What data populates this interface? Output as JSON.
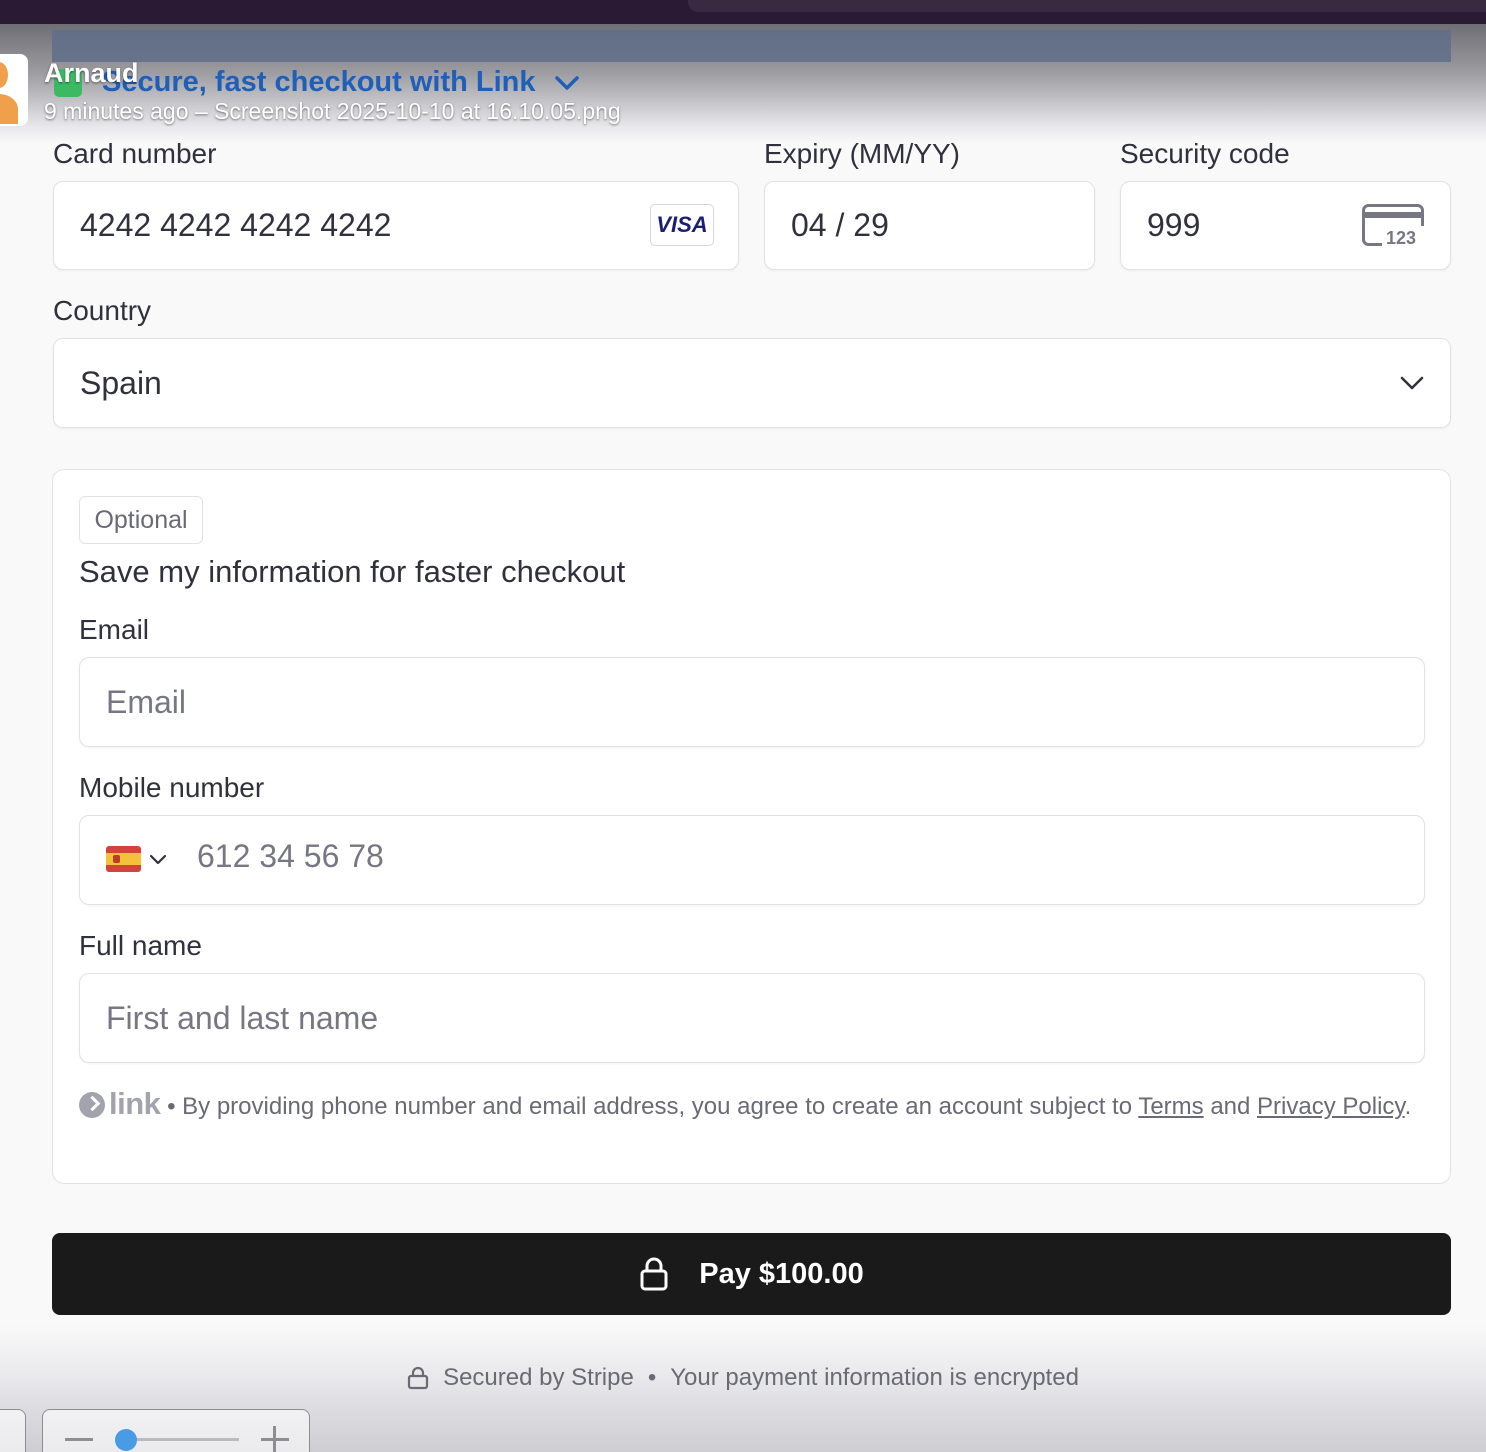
{
  "overlay": {
    "sender_name": "Arnaud",
    "sender_meta": "9 minutes ago – Screenshot 2025-10-10 at 16.10.05.png",
    "link_banner": "Secure, fast checkout with Link"
  },
  "card": {
    "number_label": "Card number",
    "number_value": "4242 4242 4242 4242",
    "brand": "VISA",
    "expiry_label": "Expiry (MM/YY)",
    "expiry_value": "04 / 29",
    "cvc_label": "Security code",
    "cvc_value": "999",
    "cvc_icon_text": "123"
  },
  "country": {
    "label": "Country",
    "value": "Spain"
  },
  "link_save": {
    "optional_badge": "Optional",
    "heading": "Save my information for faster checkout",
    "email_label": "Email",
    "email_placeholder": "Email",
    "mobile_label": "Mobile number",
    "mobile_placeholder": "612 34 56 78",
    "name_label": "Full name",
    "name_placeholder": "First and last name",
    "legal_brand": "link",
    "legal_text": " • By providing phone number and email address, you agree to create an account subject to ",
    "terms_link": "Terms",
    "legal_and": " and ",
    "privacy_link": "Privacy Policy",
    "legal_end": "."
  },
  "pay_button_label": "Pay $100.00",
  "footer": {
    "secured_text": "Secured by Stripe",
    "separator": "•",
    "encrypted_text": "Your payment information is encrypted"
  },
  "colors": {
    "accent_link_blue": "#1f5fb8",
    "pay_button": "#1a1a1a",
    "link_green": "#3cba63",
    "zoom_knob": "#4a9be6"
  },
  "icons": [
    "visa-card-icon",
    "cvc-card-icon",
    "chevron-down-icon",
    "spain-flag-icon",
    "link-arrow-icon",
    "lock-icon",
    "zoom-slider"
  ]
}
